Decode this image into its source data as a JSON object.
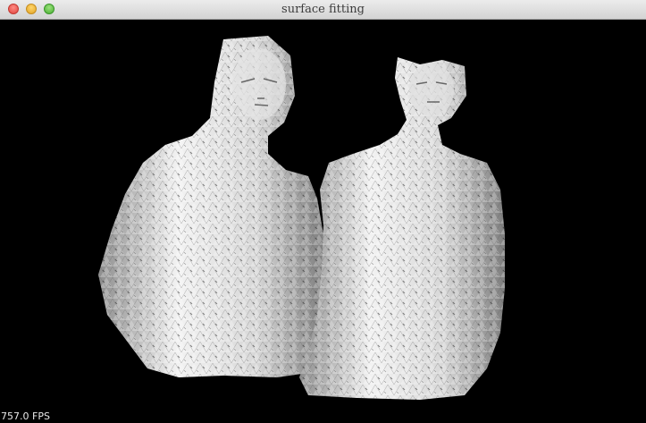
{
  "window": {
    "title": "surface fitting"
  },
  "viewport": {
    "fps_label": "757.0 FPS",
    "background_color": "#000000",
    "mesh_color": "#e6e6e6"
  },
  "icons": {
    "close": "close-traffic-light-icon",
    "minimize": "minimize-traffic-light-icon",
    "zoom": "zoom-traffic-light-icon"
  }
}
